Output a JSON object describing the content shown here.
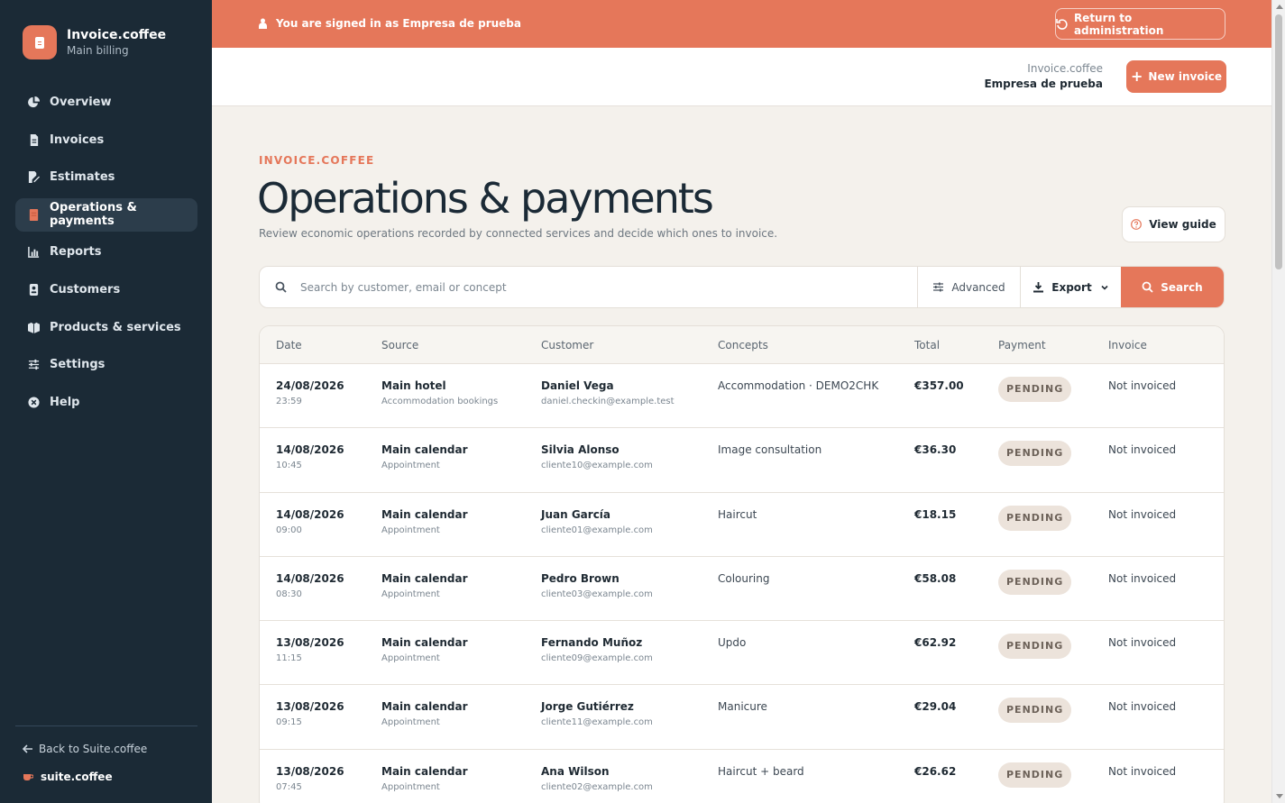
{
  "brand": {
    "name": "Invoice.coffee",
    "subtitle": "Main billing"
  },
  "sidebar": {
    "items": [
      {
        "label": "Overview",
        "icon": "pie-chart-icon"
      },
      {
        "label": "Invoices",
        "icon": "document-icon"
      },
      {
        "label": "Estimates",
        "icon": "edit-document-icon"
      },
      {
        "label": "Operations & payments",
        "icon": "receipt-icon",
        "active": true
      },
      {
        "label": "Reports",
        "icon": "bar-chart-icon"
      },
      {
        "label": "Customers",
        "icon": "contact-card-icon"
      },
      {
        "label": "Products & services",
        "icon": "boxes-icon"
      },
      {
        "label": "Settings",
        "icon": "sliders-icon"
      },
      {
        "label": "Help",
        "icon": "help-circle-icon"
      }
    ],
    "back_label": "Back to Suite.coffee",
    "suite_label": "suite.coffee"
  },
  "banner": {
    "text": "You are signed in as Empresa de prueba",
    "return_label": "Return to administration"
  },
  "topbar": {
    "app": "Invoice.coffee",
    "company": "Empresa de prueba",
    "new_invoice_label": "New invoice"
  },
  "header": {
    "eyebrow": "INVOICE.COFFEE",
    "title": "Operations & payments",
    "description": "Review economic operations recorded by connected services and decide which ones to invoice.",
    "guide_label": "View guide"
  },
  "search": {
    "placeholder": "Search by customer, email or concept",
    "advanced_label": "Advanced",
    "export_label": "Export",
    "search_label": "Search"
  },
  "table": {
    "columns": [
      "Date",
      "Source",
      "Customer",
      "Concepts",
      "Total",
      "Payment",
      "Invoice"
    ],
    "rows": [
      {
        "date": "24/08/2026",
        "time": "23:59",
        "source": "Main hotel",
        "source_sub": "Accommodation bookings",
        "customer": "Daniel Vega",
        "email": "daniel.checkin@example.test",
        "concepts": "Accommodation · DEMO2CHK",
        "total": "€357.00",
        "payment": "PENDING",
        "invoice": "Not invoiced"
      },
      {
        "date": "14/08/2026",
        "time": "10:45",
        "source": "Main calendar",
        "source_sub": "Appointment",
        "customer": "Silvia Alonso",
        "email": "cliente10@example.com",
        "concepts": "Image consultation",
        "total": "€36.30",
        "payment": "PENDING",
        "invoice": "Not invoiced"
      },
      {
        "date": "14/08/2026",
        "time": "09:00",
        "source": "Main calendar",
        "source_sub": "Appointment",
        "customer": "Juan García",
        "email": "cliente01@example.com",
        "concepts": "Haircut",
        "total": "€18.15",
        "payment": "PENDING",
        "invoice": "Not invoiced"
      },
      {
        "date": "14/08/2026",
        "time": "08:30",
        "source": "Main calendar",
        "source_sub": "Appointment",
        "customer": "Pedro Brown",
        "email": "cliente03@example.com",
        "concepts": "Colouring",
        "total": "€58.08",
        "payment": "PENDING",
        "invoice": "Not invoiced"
      },
      {
        "date": "13/08/2026",
        "time": "11:15",
        "source": "Main calendar",
        "source_sub": "Appointment",
        "customer": "Fernando Muñoz",
        "email": "cliente09@example.com",
        "concepts": "Updo",
        "total": "€62.92",
        "payment": "PENDING",
        "invoice": "Not invoiced"
      },
      {
        "date": "13/08/2026",
        "time": "09:15",
        "source": "Main calendar",
        "source_sub": "Appointment",
        "customer": "Jorge Gutiérrez",
        "email": "cliente11@example.com",
        "concepts": "Manicure",
        "total": "€29.04",
        "payment": "PENDING",
        "invoice": "Not invoiced"
      },
      {
        "date": "13/08/2026",
        "time": "07:45",
        "source": "Main calendar",
        "source_sub": "Appointment",
        "customer": "Ana Wilson",
        "email": "cliente02@example.com",
        "concepts": "Haircut + beard",
        "total": "€26.62",
        "payment": "PENDING",
        "invoice": "Not invoiced"
      }
    ]
  },
  "colors": {
    "accent": "#e5775a",
    "sidebar": "#1b2a36",
    "background": "#f4f1ec"
  }
}
